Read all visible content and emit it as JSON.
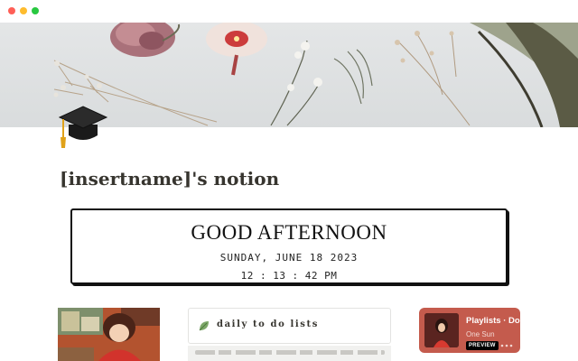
{
  "window": {
    "controls": [
      "close",
      "minimize",
      "zoom"
    ]
  },
  "cover": {
    "description_icon": "dried-flowers-cover-image"
  },
  "page": {
    "icon": "graduation-cap-icon",
    "title": "[insertname]'s notion"
  },
  "greeting_widget": {
    "greeting": "GOOD AFTERNOON",
    "date": "SUNDAY, JUNE 18 2023",
    "time": "12 : 13 : 42 PM"
  },
  "todo_card": {
    "icon": "leaf-icon",
    "title": "daily to do lists"
  },
  "spotify_embed": {
    "title": "Playlists · Do",
    "artist": "One Sun",
    "badge": "PREVIEW",
    "colors": {
      "background": "#c45b4d"
    }
  },
  "colors": {
    "text": "#37352f",
    "border": "#111111"
  }
}
